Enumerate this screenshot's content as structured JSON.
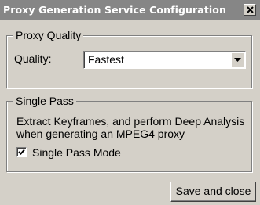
{
  "window": {
    "title": "Proxy Generation Service Configuration",
    "close_icon": "close-icon"
  },
  "proxy_quality": {
    "legend": "Proxy Quality",
    "quality_label": "Quality:",
    "quality_value": "Fastest",
    "dropdown_icon": "chevron-down-icon"
  },
  "single_pass": {
    "legend": "Single Pass",
    "description": "Extract Keyframes, and perform Deep Analysis when generating an MPEG4 proxy",
    "checkbox_label": "Single Pass Mode",
    "checked": true
  },
  "actions": {
    "save_label": "Save and close"
  },
  "colors": {
    "titlebar": "#868686",
    "face": "#d4d0c8"
  }
}
